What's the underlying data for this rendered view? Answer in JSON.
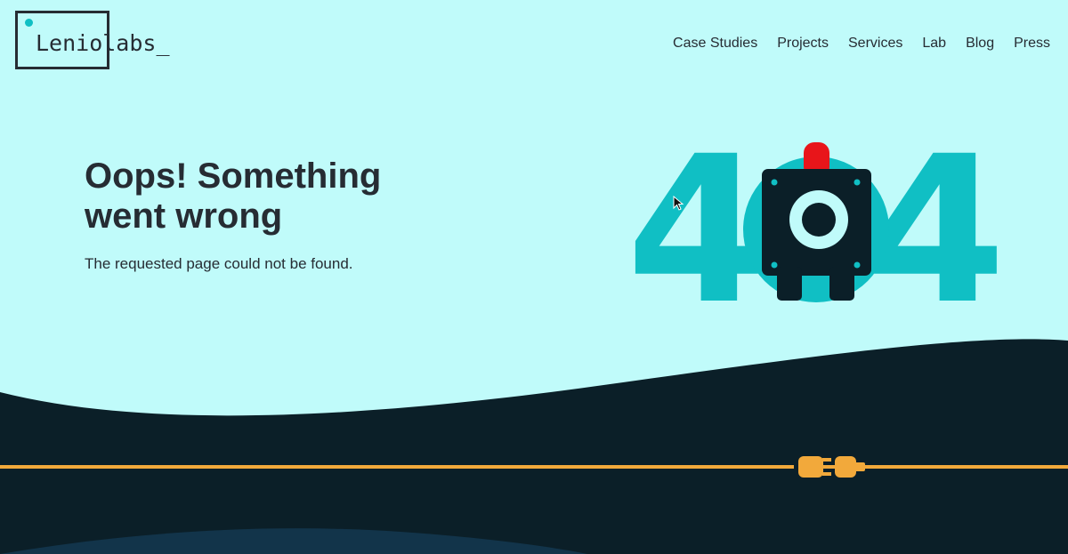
{
  "brand": {
    "logo_text": "Leniolabs_"
  },
  "nav": {
    "items": [
      {
        "label": "Case Studies"
      },
      {
        "label": "Projects"
      },
      {
        "label": "Services"
      },
      {
        "label": "Lab"
      },
      {
        "label": "Blog"
      },
      {
        "label": "Press"
      }
    ]
  },
  "error": {
    "headline": "Oops! Something went wrong",
    "message": "The requested page could not be found.",
    "code_digits": [
      "4",
      "4"
    ]
  },
  "colors": {
    "background": "#c0fbfa",
    "accent": "#10bfc4",
    "dark": "#0b1f28",
    "text": "#262c33",
    "alarm": "#e8151a",
    "plug": "#f2a93b"
  },
  "icons": {
    "robot": "robot-icon",
    "plug": "unplugged-cable-icon",
    "cursor": "mouse-pointer-icon"
  }
}
